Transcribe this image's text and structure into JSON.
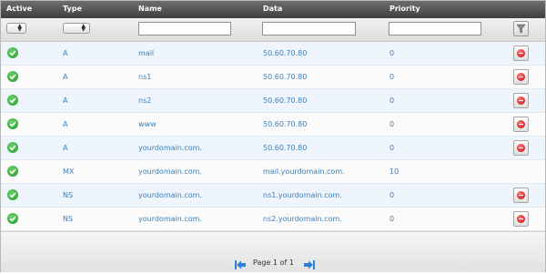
{
  "header": {
    "active": "Active",
    "type": "Type",
    "name": "Name",
    "data": "Data",
    "priority": "Priority"
  },
  "filters": {
    "name_value": "",
    "data_value": "",
    "priority_value": ""
  },
  "records": [
    {
      "type": "A",
      "name": "mail",
      "data": "50.60.70.80",
      "priority": "0"
    },
    {
      "type": "A",
      "name": "ns1",
      "data": "50.60.70.80",
      "priority": "0"
    },
    {
      "type": "A",
      "name": "ns2",
      "data": "50.60.70.80",
      "priority": "0"
    },
    {
      "type": "A",
      "name": "www",
      "data": "50.60.70.80",
      "priority": "0"
    },
    {
      "type": "A",
      "name": "yourdomain.com.",
      "data": "50.60.70.80",
      "priority": "0"
    },
    {
      "type": "MX",
      "name": "yourdomain.com.",
      "data": "mail.yourdomain.com.",
      "priority": "10"
    },
    {
      "type": "NS",
      "name": "yourdomain.com.",
      "data": "ns1.yourdomain.com.",
      "priority": "0"
    },
    {
      "type": "NS",
      "name": "yourdomain.com.",
      "data": "ns2.yourdomain.com.",
      "priority": "0"
    }
  ],
  "pager": {
    "text": "Page 1 of 1"
  },
  "icons": {
    "active": "check-circle-icon",
    "delete": "delete-icon",
    "filter": "funnel-icon",
    "first": "first-page-icon",
    "last": "last-page-icon"
  },
  "colors": {
    "header_bg": "#4f4f4f",
    "link_text": "#3a7fbd",
    "row_alt": "#eef5fd",
    "check_green": "#2aa52f",
    "delete_red": "#d40000"
  }
}
